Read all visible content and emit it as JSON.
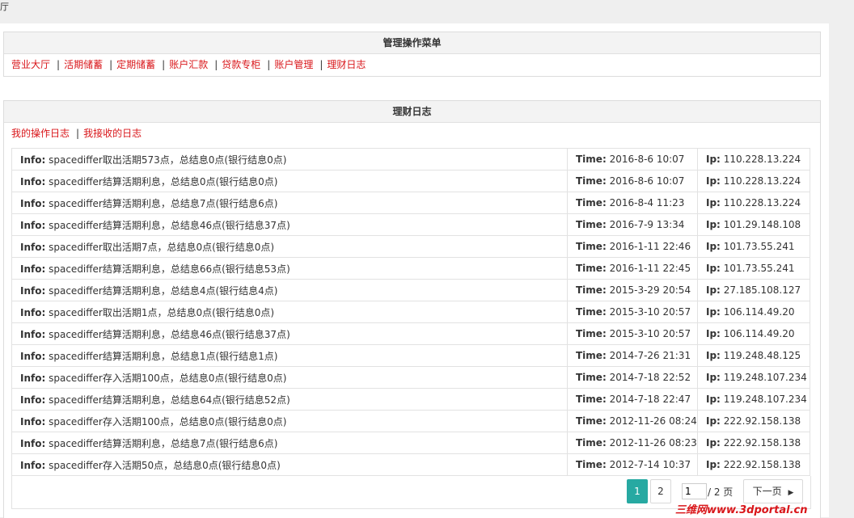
{
  "top": {
    "text": "厅"
  },
  "menu_panel": {
    "title": "管理操作菜单",
    "links": [
      "营业大厅",
      "活期储蓄",
      "定期储蓄",
      "账户汇款",
      "贷款专柜",
      "账户管理",
      "理财日志"
    ],
    "separator": "|"
  },
  "log_panel": {
    "title": "理财日志",
    "sub_links": [
      "我的操作日志",
      "我接收的日志"
    ],
    "labels": {
      "info": "Info:",
      "time": "Time:",
      "ip": "Ip:"
    },
    "rows": [
      {
        "info": "spacediffer取出活期573点，总结息0点(银行结息0点)",
        "time": "2016-8-6 10:07",
        "ip": "110.228.13.224"
      },
      {
        "info": "spacediffer结算活期利息，总结息0点(银行结息0点)",
        "time": "2016-8-6 10:07",
        "ip": "110.228.13.224"
      },
      {
        "info": "spacediffer结算活期利息，总结息7点(银行结息6点)",
        "time": "2016-8-4 11:23",
        "ip": "110.228.13.224"
      },
      {
        "info": "spacediffer结算活期利息，总结息46点(银行结息37点)",
        "time": "2016-7-9 13:34",
        "ip": "101.29.148.108"
      },
      {
        "info": "spacediffer取出活期7点，总结息0点(银行结息0点)",
        "time": "2016-1-11 22:46",
        "ip": "101.73.55.241"
      },
      {
        "info": "spacediffer结算活期利息，总结息66点(银行结息53点)",
        "time": "2016-1-11 22:45",
        "ip": "101.73.55.241"
      },
      {
        "info": "spacediffer结算活期利息，总结息4点(银行结息4点)",
        "time": "2015-3-29 20:54",
        "ip": "27.185.108.127"
      },
      {
        "info": "spacediffer取出活期1点，总结息0点(银行结息0点)",
        "time": "2015-3-10 20:57",
        "ip": "106.114.49.20"
      },
      {
        "info": "spacediffer结算活期利息，总结息46点(银行结息37点)",
        "time": "2015-3-10 20:57",
        "ip": "106.114.49.20"
      },
      {
        "info": "spacediffer结算活期利息，总结息1点(银行结息1点)",
        "time": "2014-7-26 21:31",
        "ip": "119.248.48.125"
      },
      {
        "info": "spacediffer存入活期100点，总结息0点(银行结息0点)",
        "time": "2014-7-18 22:52",
        "ip": "119.248.107.234"
      },
      {
        "info": "spacediffer结算活期利息，总结息64点(银行结息52点)",
        "time": "2014-7-18 22:47",
        "ip": "119.248.107.234"
      },
      {
        "info": "spacediffer存入活期100点，总结息0点(银行结息0点)",
        "time": "2012-11-26 08:24",
        "ip": "222.92.158.138"
      },
      {
        "info": "spacediffer结算活期利息，总结息7点(银行结息6点)",
        "time": "2012-11-26 08:23",
        "ip": "222.92.158.138"
      },
      {
        "info": "spacediffer存入活期50点，总结息0点(银行结息0点)",
        "time": "2012-7-14 10:37",
        "ip": "222.92.158.138"
      }
    ]
  },
  "pagination": {
    "pages": [
      "1",
      "2"
    ],
    "current_page": "1",
    "input_value": "1",
    "total_text": "/ 2 页",
    "next_label": "下一页",
    "next_icon": "triangle-right-icon",
    "active_color": "#27a9a2"
  },
  "watermark": {
    "text": "三维网www.3dportal.cn"
  },
  "colors": {
    "link": "#d9161a",
    "header_bg": "#f3f3f3"
  }
}
